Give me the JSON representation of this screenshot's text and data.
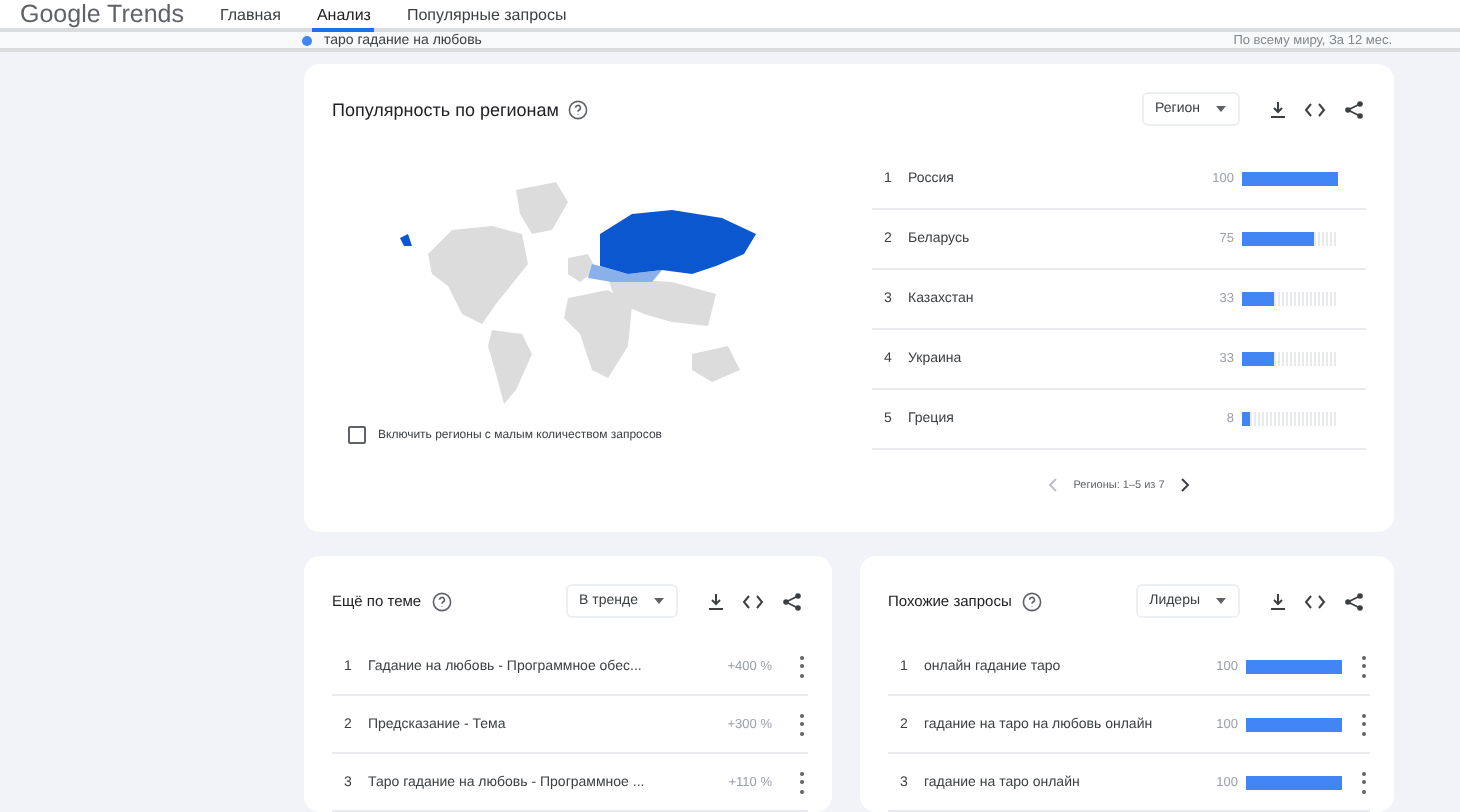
{
  "header": {
    "logo": "Google Trends",
    "nav": [
      {
        "label": "Главная",
        "selected": false
      },
      {
        "label": "Анализ",
        "selected": true
      },
      {
        "label": "Популярные запросы",
        "selected": false
      }
    ]
  },
  "query_bar": {
    "term": "таро гадание на любовь",
    "color": "#4285f4",
    "scope": "По всему миру, За 12 мес."
  },
  "regions_card": {
    "title": "Популярность по регионам",
    "dropdown": "Регион",
    "checkbox": {
      "label": "Включить регионы с малым количеством запросов",
      "checked": false
    },
    "rows": [
      {
        "rank": "1",
        "name": "Россия",
        "value": "100",
        "level": 1.0
      },
      {
        "rank": "2",
        "name": "Беларусь",
        "value": "75",
        "level": 0.75
      },
      {
        "rank": "3",
        "name": "Казахстан",
        "value": "33",
        "level": 0.33
      },
      {
        "rank": "4",
        "name": "Украина",
        "value": "33",
        "level": 0.33
      },
      {
        "rank": "5",
        "name": "Греция",
        "value": "8",
        "level": 0.08
      }
    ],
    "pager": "Регионы: 1–5 из 7"
  },
  "topics_card": {
    "title": "Ещё по теме",
    "dropdown": "В тренде",
    "rows": [
      {
        "rank": "1",
        "name": "Гадание на любовь - Программное обес...",
        "value": "+400 %"
      },
      {
        "rank": "2",
        "name": "Предсказание - Тема",
        "value": "+300 %"
      },
      {
        "rank": "3",
        "name": "Таро гадание на любовь - Программное ...",
        "value": "+110 %"
      }
    ]
  },
  "queries_card": {
    "title": "Похожие запросы",
    "dropdown": "Лидеры",
    "rows": [
      {
        "rank": "1",
        "name": "онлайн гадание таро",
        "value": "100",
        "level": 1.0
      },
      {
        "rank": "2",
        "name": "гадание на таро на любовь онлайн",
        "value": "100",
        "level": 1.0
      },
      {
        "rank": "3",
        "name": "гадание на таро онлайн",
        "value": "100",
        "level": 1.0
      }
    ]
  }
}
